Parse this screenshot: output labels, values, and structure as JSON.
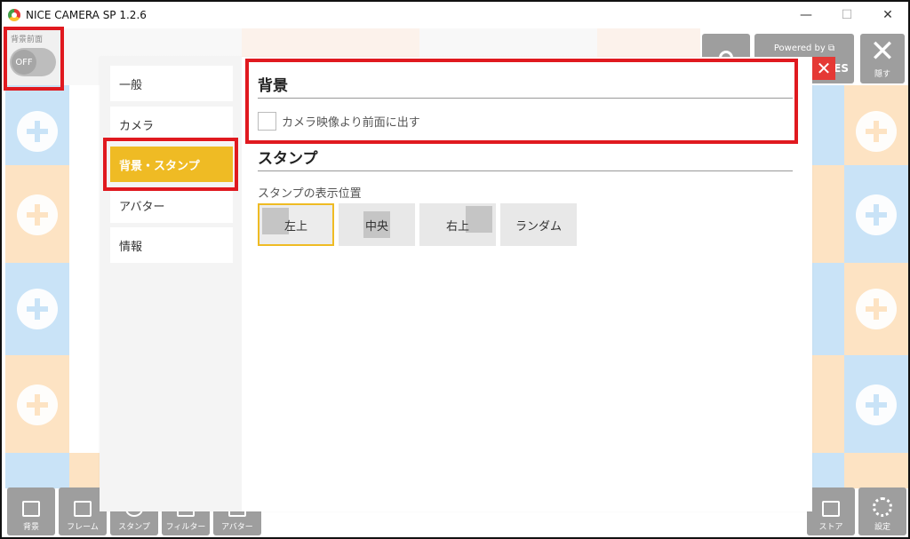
{
  "app": {
    "title": "NICE CAMERA SP 1.2.6"
  },
  "window_controls": {
    "minimize": "—",
    "maximize": "☐",
    "close": "✕"
  },
  "bg_toggle": {
    "label": "背景前面",
    "state": "OFF"
  },
  "top_right": {
    "powered_label": "Powered by ⧉",
    "powered_sub": "ES",
    "hide_label": "隠す",
    "hide_icon": "✕"
  },
  "dialog": {
    "close_icon": "✕",
    "sidebar": [
      {
        "label": "一般"
      },
      {
        "label": "カメラ"
      },
      {
        "label": "背景・スタンプ"
      },
      {
        "label": "アバター"
      },
      {
        "label": "情報"
      }
    ],
    "background_section": {
      "title": "背景",
      "checkbox_label": "カメラ映像より前面に出す"
    },
    "stamp_section": {
      "title": "スタンプ",
      "position_label": "スタンプの表示位置",
      "positions": [
        {
          "label": "左上"
        },
        {
          "label": "中央"
        },
        {
          "label": "右上"
        },
        {
          "label": "ランダム"
        }
      ]
    }
  },
  "bottom_toolbar": {
    "left": [
      {
        "label": "背景"
      },
      {
        "label": "フレーム"
      },
      {
        "label": "スタンプ"
      },
      {
        "label": "フィルター"
      },
      {
        "label": "アバター"
      }
    ],
    "right": [
      {
        "label": "ストア"
      },
      {
        "label": "設定"
      }
    ]
  },
  "colors": {
    "accent": "#efbb24",
    "highlight": "#e0191f",
    "close": "#e53935",
    "tile_blue": "#c9e3f7",
    "tile_peach": "#fde3c3"
  }
}
